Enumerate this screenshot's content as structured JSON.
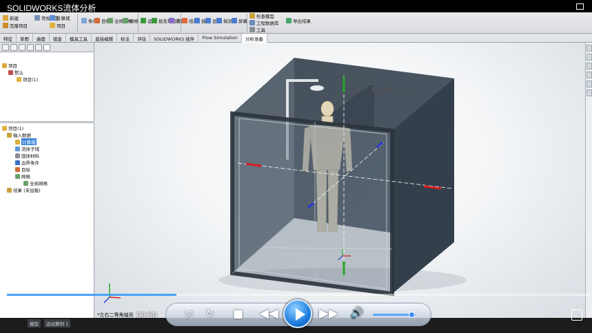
{
  "window": {
    "title": "SOLIDWORKS流体分析"
  },
  "ribbon": {
    "items": [
      {
        "label": "新建",
        "icon": "new-icon"
      },
      {
        "label": "克隆项目",
        "icon": "clone-project-icon"
      },
      {
        "label": "常规设置",
        "icon": "general-settings-icon"
      },
      {
        "label": "计算域",
        "icon": "computational-domain-icon"
      },
      {
        "label": "项目",
        "icon": "project-icon"
      },
      {
        "label": "条件",
        "icon": "conditions-icon"
      },
      {
        "label": "目标",
        "icon": "goals-icon"
      },
      {
        "label": "全局网格",
        "icon": "global-mesh-icon"
      },
      {
        "label": "网格...",
        "icon": "mesh-icon"
      },
      {
        "label": "运行",
        "icon": "run-icon"
      },
      {
        "label": "批处理运行",
        "icon": "batch-run-icon"
      },
      {
        "label": "求解",
        "icon": "solve-icon"
      },
      {
        "label": "结果",
        "icon": "results-icon"
      },
      {
        "label": "插入",
        "icon": "insert-icon"
      },
      {
        "label": "显示",
        "icon": "display-icon"
      },
      {
        "label": "探测值",
        "icon": "probe-icon"
      },
      {
        "label": "屏幕...",
        "icon": "screen-icon"
      },
      {
        "label": "检查模型",
        "icon": "check-model-icon"
      },
      {
        "label": "工程数据库",
        "icon": "engineering-database-icon"
      },
      {
        "label": "工具",
        "icon": "tools-icon"
      },
      {
        "label": "导出结果",
        "icon": "export-results-icon"
      }
    ]
  },
  "tabs": [
    {
      "label": "特征"
    },
    {
      "label": "草图"
    },
    {
      "label": "曲面"
    },
    {
      "label": "钣金"
    },
    {
      "label": "模具工具"
    },
    {
      "label": "直接编辑"
    },
    {
      "label": "标注"
    },
    {
      "label": "评估"
    },
    {
      "label": "SOLIDWORKS 插件"
    },
    {
      "label": "Flow Simulation"
    },
    {
      "label": "分析准备"
    }
  ],
  "tree_top": [
    {
      "label": "项目",
      "indent": 0
    },
    {
      "label": "默认",
      "indent": 1
    },
    {
      "label": "项目(1)",
      "indent": 2
    }
  ],
  "tree_bottom": [
    {
      "label": "项目(1)",
      "indent": 0
    },
    {
      "label": "输入数据",
      "indent": 1
    },
    {
      "label": "计算域",
      "indent": 2,
      "selected": true
    },
    {
      "label": "流体子域",
      "indent": 2
    },
    {
      "label": "固体材料",
      "indent": 2
    },
    {
      "label": "边界条件",
      "indent": 2
    },
    {
      "label": "目标",
      "indent": 2
    },
    {
      "label": "网格",
      "indent": 2
    },
    {
      "label": "全局网格",
      "indent": 3
    },
    {
      "label": "结果 (未加载)",
      "indent": 1
    }
  ],
  "statusbar": {
    "tabs": [
      "模型",
      "运动算例 1"
    ]
  },
  "player": {
    "time": "00:59",
    "view_label": "*左右二等角轴测",
    "progress": 0.29,
    "volume": 0.9
  },
  "colors": {
    "accent": "#1f7fe0",
    "selection": "#3b84d8"
  }
}
